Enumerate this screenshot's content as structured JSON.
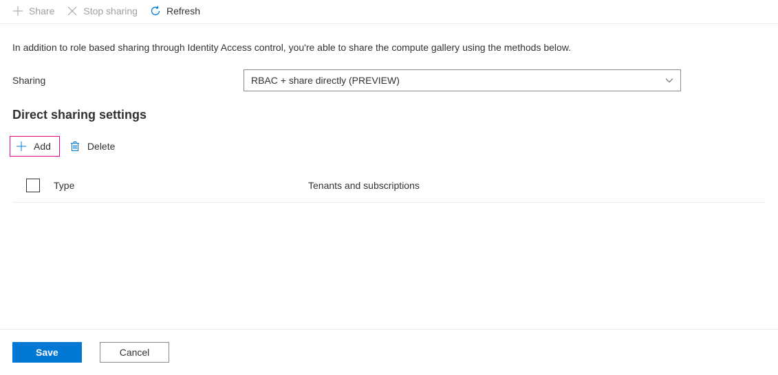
{
  "toolbar": {
    "share_label": "Share",
    "stop_sharing_label": "Stop sharing",
    "refresh_label": "Refresh"
  },
  "description": "In addition to role based sharing through Identity Access control, you're able to share the compute gallery using the methods below.",
  "form": {
    "sharing_label": "Sharing",
    "sharing_value": "RBAC + share directly (PREVIEW)"
  },
  "section_heading": "Direct sharing settings",
  "actions": {
    "add_label": "Add",
    "delete_label": "Delete"
  },
  "table": {
    "columns": {
      "type": "Type",
      "tenants": "Tenants and subscriptions"
    }
  },
  "footer": {
    "save_label": "Save",
    "cancel_label": "Cancel"
  }
}
